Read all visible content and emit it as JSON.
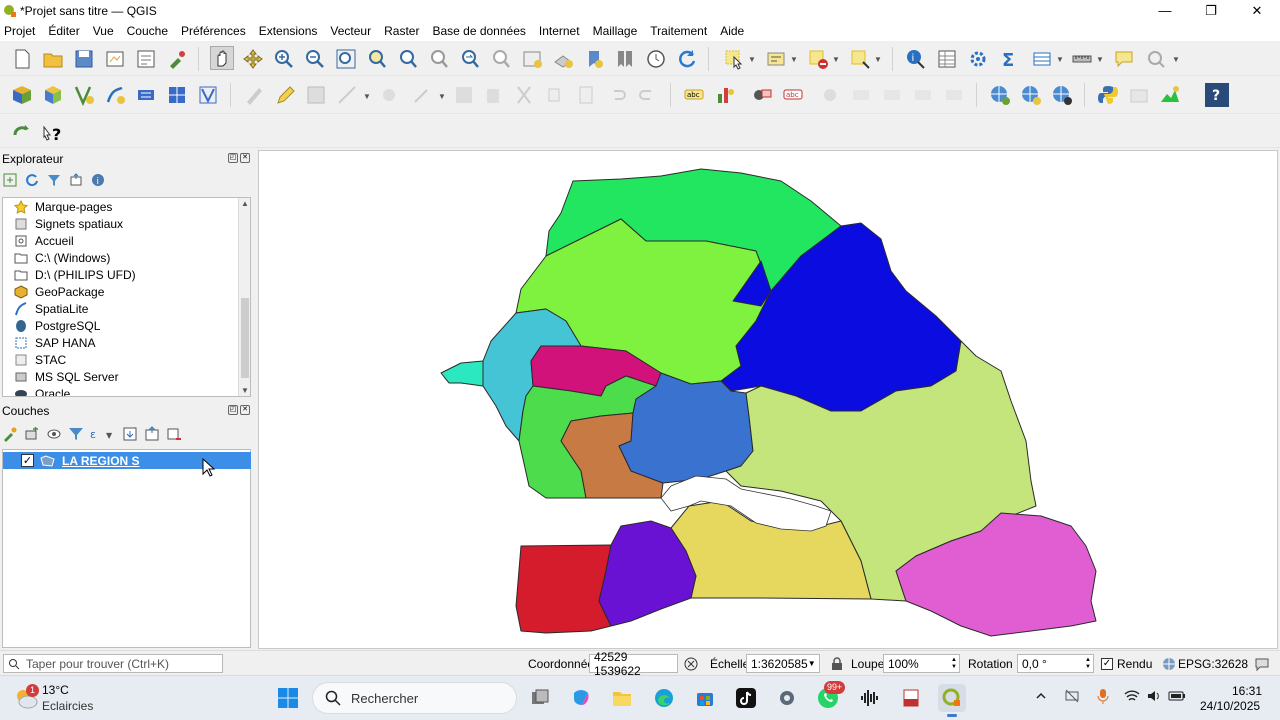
{
  "window": {
    "title": "*Projet sans titre — QGIS",
    "minimize": "—",
    "maximize": "❐",
    "close": "✕"
  },
  "menu": [
    "Projet",
    "Éditer",
    "Vue",
    "Couche",
    "Préférences",
    "Extensions",
    "Vecteur",
    "Raster",
    "Base de données",
    "Internet",
    "Maillage",
    "Traitement",
    "Aide"
  ],
  "explorer": {
    "title": "Explorateur",
    "items": [
      {
        "label": "Marque-pages",
        "icon": "star-icon"
      },
      {
        "label": "Signets spatiaux",
        "icon": "bookmark-icon"
      },
      {
        "label": "Accueil",
        "icon": "home-folder-icon"
      },
      {
        "label": "C:\\ (Windows)",
        "icon": "folder-icon"
      },
      {
        "label": "D:\\ (PHILIPS UFD)",
        "icon": "folder-icon"
      },
      {
        "label": "GeoPackage",
        "icon": "geopackage-icon"
      },
      {
        "label": "SpatiaLite",
        "icon": "spatialite-icon"
      },
      {
        "label": "PostgreSQL",
        "icon": "postgresql-icon"
      },
      {
        "label": "SAP HANA",
        "icon": "sap-hana-icon"
      },
      {
        "label": "STAC",
        "icon": "stac-icon"
      },
      {
        "label": "MS SQL Server",
        "icon": "mssql-icon"
      },
      {
        "label": "Oracle",
        "icon": "oracle-icon"
      }
    ]
  },
  "layers": {
    "title": "Couches",
    "items": [
      {
        "name": "LA REGION S",
        "checked": true
      }
    ]
  },
  "map": {
    "regions": [
      {
        "name": "north",
        "color": "#22e660"
      },
      {
        "name": "north-center",
        "color": "#7ef23e"
      },
      {
        "name": "northeast",
        "color": "#0b0de0"
      },
      {
        "name": "west",
        "color": "#44c4d4"
      },
      {
        "name": "cap-vert",
        "color": "#2ce8c0"
      },
      {
        "name": "diourbel",
        "color": "#d0127a"
      },
      {
        "name": "center-west",
        "color": "#4cdc4c"
      },
      {
        "name": "kaolack",
        "color": "#c87a44"
      },
      {
        "name": "center",
        "color": "#3a72d0"
      },
      {
        "name": "east",
        "color": "#c4e47c"
      },
      {
        "name": "southeast",
        "color": "#e05ed2"
      },
      {
        "name": "south-center",
        "color": "#e6d85e"
      },
      {
        "name": "south-west",
        "color": "#d41c2c"
      },
      {
        "name": "south",
        "color": "#6a12d4"
      }
    ]
  },
  "status": {
    "search_placeholder": "Taper pour trouver (Ctrl+K)",
    "coord_label": "Coordonnée",
    "coord_value": "42529  1539622",
    "scale_label": "Échelle",
    "scale_value": "1:3620585",
    "magnifier_label": "Loupe",
    "magnifier_value": "100%",
    "rotation_label": "Rotation",
    "rotation_value": "0,0 °",
    "render_label": "Rendu",
    "crs": "EPSG:32628"
  },
  "taskbar": {
    "weather_temp": "13°C",
    "weather_desc": "Eclaircies",
    "weather_badge": "1",
    "search": "Rechercher",
    "whatsapp_badge": "99+",
    "time": "16:31",
    "date": "24/10/2025"
  }
}
